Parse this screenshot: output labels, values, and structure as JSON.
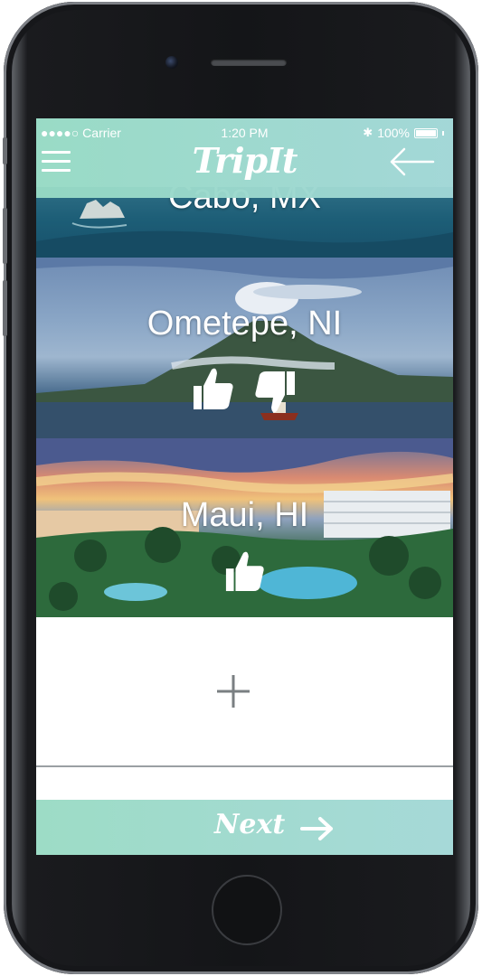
{
  "status_bar": {
    "carrier": "●●●●○ Carrier",
    "time": "1:20 PM",
    "battery": "100%"
  },
  "header": {
    "logo": "TripIt",
    "menu_icon": "hamburger-menu-icon",
    "back_icon": "arrow-left-icon"
  },
  "destinations": [
    {
      "name": "Cabo, MX"
    },
    {
      "name": "Ometepe, NI",
      "actions": [
        "thumbs-up-icon",
        "thumbs-down-icon"
      ]
    },
    {
      "name": "Maui, HI",
      "actions": [
        "thumbs-up-icon"
      ]
    }
  ],
  "add_button": {
    "icon": "plus-icon"
  },
  "footer": {
    "next_label": "Next",
    "next_icon": "arrow-right-icon"
  },
  "colors": {
    "accent": "#9ddcc6",
    "header": "#96dac4"
  }
}
